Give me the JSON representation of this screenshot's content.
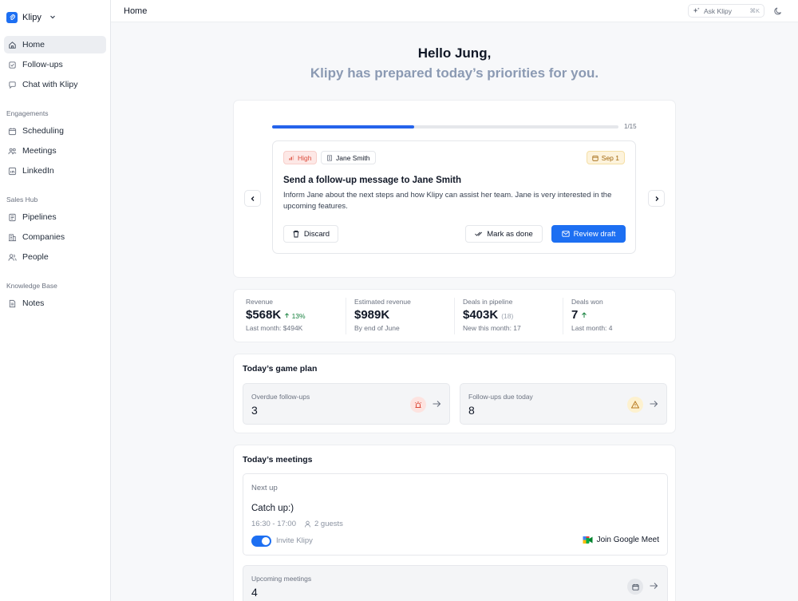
{
  "app": {
    "name": "Klipy"
  },
  "sidebar": {
    "main": [
      {
        "label": "Home",
        "icon": "home-icon"
      },
      {
        "label": "Follow-ups",
        "icon": "follow-ups-icon"
      },
      {
        "label": "Chat with Klipy",
        "icon": "chat-icon"
      }
    ],
    "sections": [
      {
        "label": "Engagements",
        "items": [
          {
            "label": "Scheduling"
          },
          {
            "label": "Meetings"
          },
          {
            "label": "LinkedIn"
          }
        ]
      },
      {
        "label": "Sales Hub",
        "items": [
          {
            "label": "Pipelines"
          },
          {
            "label": "Companies"
          },
          {
            "label": "People"
          }
        ]
      },
      {
        "label": "Knowledge Base",
        "items": [
          {
            "label": "Notes"
          }
        ]
      }
    ]
  },
  "header": {
    "title": "Home",
    "ask_label": "Ask Klipy",
    "ask_shortcut": "⌘K"
  },
  "greeting": {
    "hello": "Hello Jung,",
    "subtitle": "Klipy has prepared today’s priorities for you."
  },
  "priority": {
    "progress_label": "1/15",
    "progress_fraction": 0.41,
    "tag_priority": "High",
    "tag_person": "Jane Smith",
    "tag_date": "Sep 1",
    "title": "Send a follow-up message to Jane Smith",
    "description": "Inform Jane about the next steps and how Klipy can assist her team. Jane is very interested in the upcoming features.",
    "discard_label": "Discard",
    "done_label": "Mark as done",
    "review_label": "Review draft"
  },
  "stats": [
    {
      "label": "Revenue",
      "value": "$568K",
      "badge": "13%",
      "foot": "Last month: $494K"
    },
    {
      "label": "Estimated revenue",
      "value": "$989K",
      "foot": "By end of June"
    },
    {
      "label": "Deals in pipeline",
      "value": "$403K",
      "paren": "(18)",
      "foot": "New this month: 17"
    },
    {
      "label": "Deals won",
      "value": "7",
      "foot": "Last month: 4"
    }
  ],
  "game_plan": {
    "title": "Today’s game plan",
    "overdue": {
      "label": "Overdue follow-ups",
      "count": "3"
    },
    "due_today": {
      "label": "Follow-ups due today",
      "count": "8"
    }
  },
  "meetings": {
    "title": "Today’s meetings",
    "next_up_label": "Next up",
    "next": {
      "title": "Catch up:)",
      "time": "16:30 - 17:00",
      "guests": "2 guests",
      "invite_label": "Invite Klipy",
      "invite_enabled": true,
      "join_label": "Join Google Meet"
    },
    "upcoming": {
      "label": "Upcoming meetings",
      "count": "4"
    }
  },
  "colors": {
    "accent": "#1d6ff2",
    "high": "#dc4a3a",
    "date": "#a0650b",
    "positive": "#15803d"
  }
}
